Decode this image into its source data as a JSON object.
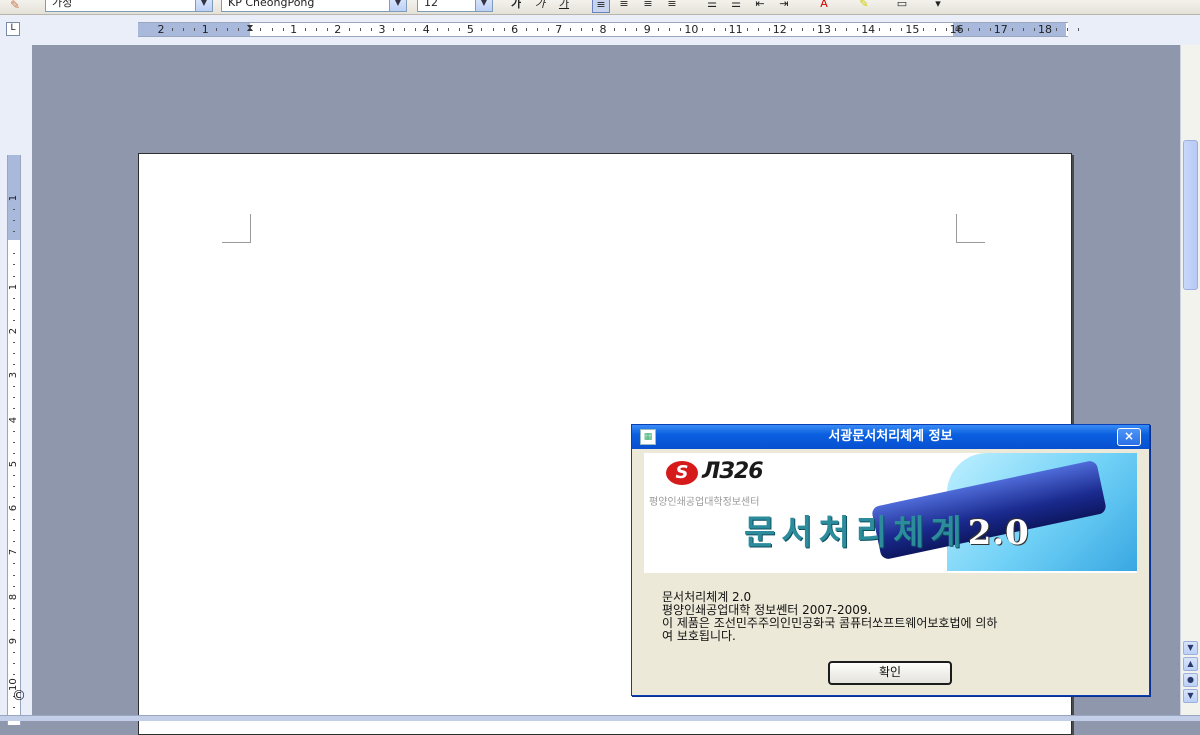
{
  "toolbar": {
    "style_combo": "가정",
    "font_combo": "KP CheongPong",
    "size_combo": "12"
  },
  "ruler": {
    "h_labels": [
      "2",
      "1",
      "",
      "1",
      "2",
      "3",
      "4",
      "5",
      "6",
      "7",
      "8",
      "9",
      "10",
      "11",
      "12",
      "13",
      "14",
      "15",
      "16",
      "17",
      "18"
    ],
    "v_labels": [
      "1",
      "",
      "1",
      "2",
      "3",
      "4",
      "5",
      "6",
      "7",
      "8",
      "9",
      "10"
    ]
  },
  "status": {
    "copyright_glyph": "©"
  },
  "dialog": {
    "title": "서광문서처리체계 정보",
    "close_glyph": "×",
    "logo_mark": "S",
    "logo_text": "ЛЗ26",
    "org_small": "평양인쇄공업대학정보센터",
    "product_name": "문서처리체계",
    "product_version": "2.0",
    "info_lines": [
      "문서처리체계 2.0",
      "평양인쇄공업대학 정보쎈터 2007-2009.",
      "이 제품은 조선민주주의인민공화국 콤퓨터쏘프트웨어보호법에 의하",
      "여 보호됩니다."
    ],
    "ok_label": "확인"
  }
}
